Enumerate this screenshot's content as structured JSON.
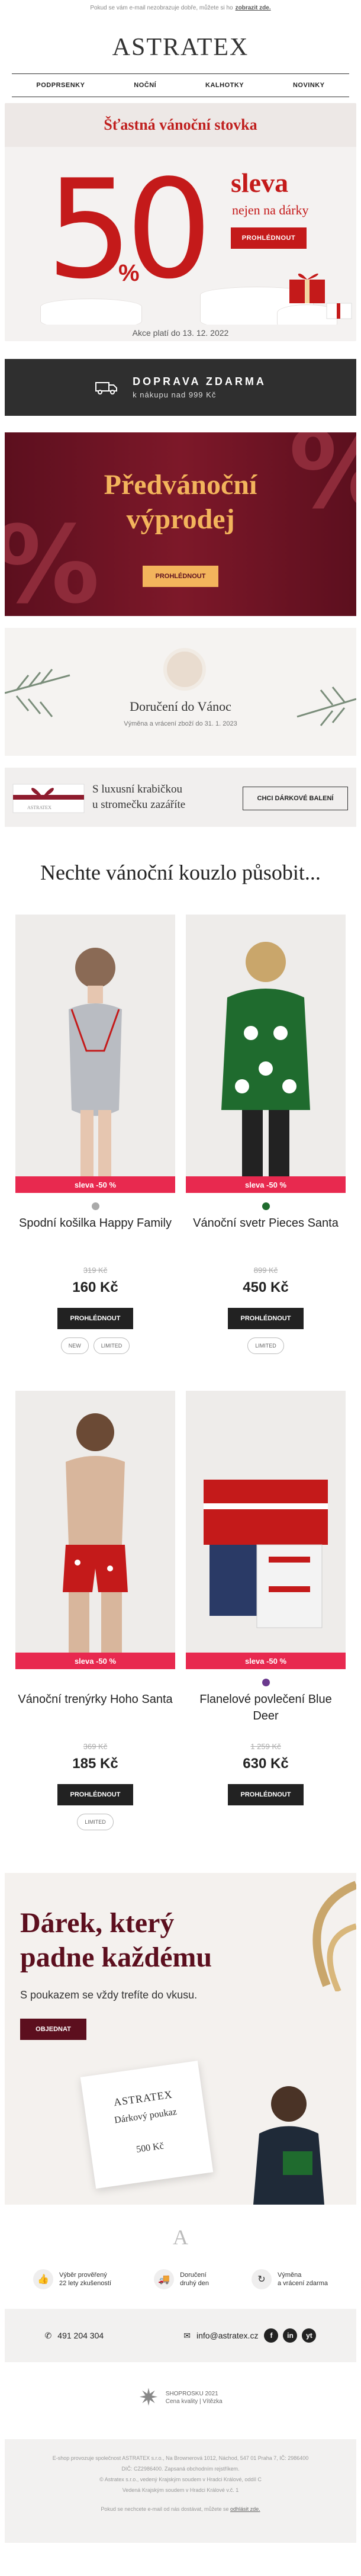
{
  "preheader": {
    "text": "Pokud se vám e-mail nezobrazuje dobře, můžete si ho",
    "link": "zobrazit zde."
  },
  "brand": "ASTRATEX",
  "nav": [
    "PODPRSENKY",
    "NOČNÍ",
    "KALHOTKY",
    "NOVINKY"
  ],
  "hero": {
    "title": "Šťastná vánoční stovka",
    "big": "50",
    "percent": "%",
    "sleva": "sleva",
    "subtitle": "nejen na dárky",
    "button": "PROHLÉDNOUT",
    "validity": "Akce platí do 13. 12. 2022"
  },
  "shipping": {
    "title": "DOPRAVA ZDARMA",
    "subtitle": "k nákupu nad 999 Kč",
    "icon": "truck-icon"
  },
  "promo": {
    "title_line1": "Předvánoční",
    "title_line2": "výprodej",
    "button": "PROHLÉDNOUT"
  },
  "delivery": {
    "title": "Doručení do Vánoc",
    "subtitle": "Výměna a vrácení zboží do 31. 1. 2023"
  },
  "giftbox": {
    "line1": "S luxusní krabičkou",
    "line2": "u stromečku zazáříte",
    "button": "CHCI DÁRKOVÉ BALENÍ"
  },
  "section_title": "Nechte vánoční kouzlo působit...",
  "products": [
    {
      "name": "Spodní košilka Happy Family",
      "badge": "sleva -50 %",
      "old_price": "319 Kč",
      "price": "160 Kč",
      "button": "PROHLÉDNOUT",
      "dot_color": "#a9a9a9",
      "tags": [
        "NEW",
        "LIMITED"
      ]
    },
    {
      "name": "Vánoční svetr Pieces Santa",
      "badge": "sleva -50 %",
      "old_price": "899 Kč",
      "price": "450 Kč",
      "button": "PROHLÉDNOUT",
      "dot_color": "#1f6b2e",
      "tags": [
        "LIMITED"
      ]
    },
    {
      "name": "Vánoční trenýrky Hoho Santa",
      "badge": "sleva -50 %",
      "old_price": "369 Kč",
      "price": "185 Kč",
      "button": "PROHLÉDNOUT",
      "dot_color": "",
      "tags": [
        "LIMITED"
      ]
    },
    {
      "name": "Flanelové povlečení Blue Deer",
      "badge": "sleva -50 %",
      "old_price": "1 259 Kč",
      "price": "630 Kč",
      "button": "PROHLÉDNOUT",
      "dot_color": "#6b3a8e",
      "tags": []
    }
  ],
  "voucher": {
    "title_line1": "Dárek, který",
    "title_line2": "padne každému",
    "subtitle": "S poukazem se vždy trefíte do vkusu.",
    "button": "OBJEDNAT",
    "card_brand": "ASTRATEX",
    "card_title": "Dárkový poukaz",
    "card_value": "500 Kč"
  },
  "footer_logo": "A",
  "benefits": [
    {
      "icon": "thumbs-up-icon",
      "line1": "Výběr prověřený",
      "line2": "22 lety zkušeností"
    },
    {
      "icon": "truck-icon",
      "line1": "Doručení",
      "line2": "druhý den"
    },
    {
      "icon": "return-icon",
      "line1": "Výměna",
      "line2": "a vrácení zdarma"
    }
  ],
  "contact": {
    "phone": "491 204 304",
    "email": "info@astratex.cz",
    "social": [
      "f",
      "in",
      "yt"
    ]
  },
  "award": {
    "line1": "SHOPROSKU 2021",
    "line2": "Cena kvality | Vítězka"
  },
  "legal": {
    "line1": "E-shop provozuje společnost ASTRATEX s.r.o., Na Brownerová 1012, Náchod, 547 01 Praha 7, IČ: 2986400",
    "line2": "DIČ: CZ2986400. Zapsaná obchodním rejstříkem.",
    "line3": "© Astratex s.r.o., vedený Krajským soudem v Hradci Králové, oddíl C",
    "line4": "Vedená Krajským soudem v Hradci Králové v.č. 1",
    "line5": "Pokud se nechcete e-mail od nás dostávat, můžete se",
    "unsubscribe": "odhlásit zde."
  }
}
